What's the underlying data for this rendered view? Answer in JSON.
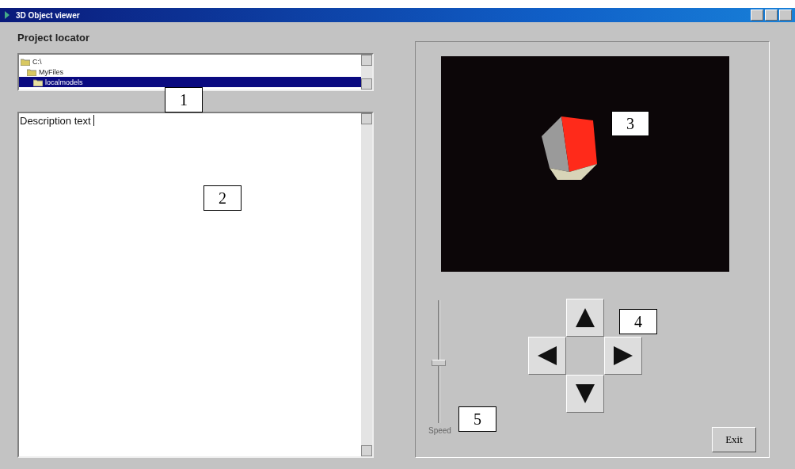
{
  "window": {
    "title": "3D Object viewer"
  },
  "heading": "Project locator",
  "tree": {
    "items": [
      {
        "label": "C:\\",
        "selected": false,
        "children": [
          {
            "label": "MyFiles",
            "selected": false,
            "children": [
              {
                "label": "localmodels",
                "selected": true
              }
            ]
          }
        ]
      }
    ]
  },
  "description": {
    "value": "Description text"
  },
  "speed": {
    "label": "Speed",
    "level": 0.5
  },
  "buttons": [
    "Exit"
  ],
  "callouts": [
    "1",
    "2",
    "3",
    "4",
    "5"
  ]
}
